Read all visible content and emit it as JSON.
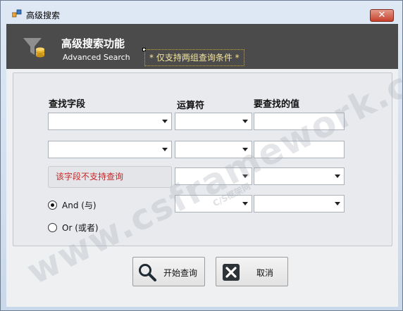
{
  "window": {
    "title": "高级搜索",
    "close_label": "✕"
  },
  "banner": {
    "title": "高级搜索功能",
    "subtitle": "Advanced Search",
    "note": "* 仅支持两组查询条件 *",
    "icon": "funnel-database-icon"
  },
  "headers": {
    "field": "查找字段",
    "operator": "运算符",
    "value": "要查找的值"
  },
  "rows": [
    {
      "field": "",
      "operator": "",
      "value": ""
    },
    {
      "field": "",
      "operator": "",
      "value": ""
    },
    {
      "field_message": "该字段不支持查询",
      "operator": "",
      "value": ""
    },
    {
      "operator": "",
      "value": ""
    }
  ],
  "logic": {
    "and_label": "And (与)",
    "or_label": "Or (或者)",
    "selected": "and"
  },
  "buttons": {
    "search_label": "开始查询",
    "search_icon": "magnifier-icon",
    "cancel_label": "取消",
    "cancel_icon": "close-x-icon"
  },
  "watermark": {
    "main": "www.csframework.com",
    "sub": "C/S框架网"
  },
  "colors": {
    "banner_bg": "#4b4b4b",
    "note_text": "#f4e4a0",
    "error_text": "#c62828"
  }
}
